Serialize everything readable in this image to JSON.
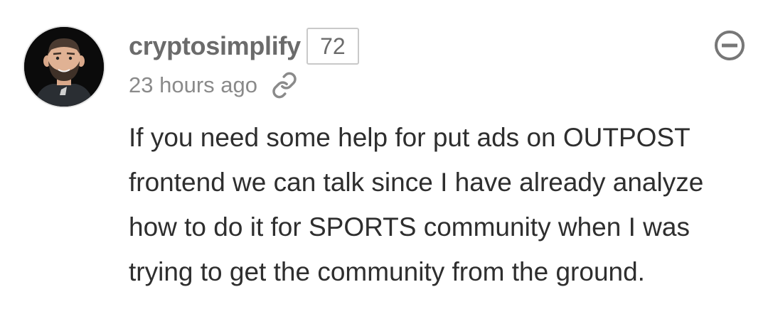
{
  "comment": {
    "author": {
      "username": "cryptosimplify",
      "reputation": "72",
      "avatar_icon": "user-avatar-bearded-man"
    },
    "timestamp": "23 hours ago",
    "icons": {
      "permalink": "link-icon",
      "collapse": "minus-circle-icon"
    },
    "body": "If you need some help for put ads on OUTPOST frontend we can talk since I have already analyze how to do it for SPORTS community when I was trying to get the community from the ground."
  },
  "colors": {
    "username": "#6b6b6b",
    "timestamp": "#8a8a8a",
    "body_text": "#2e2e2e",
    "badge_border": "#c9c9c9",
    "avatar_bg": "#0b0b0b"
  }
}
